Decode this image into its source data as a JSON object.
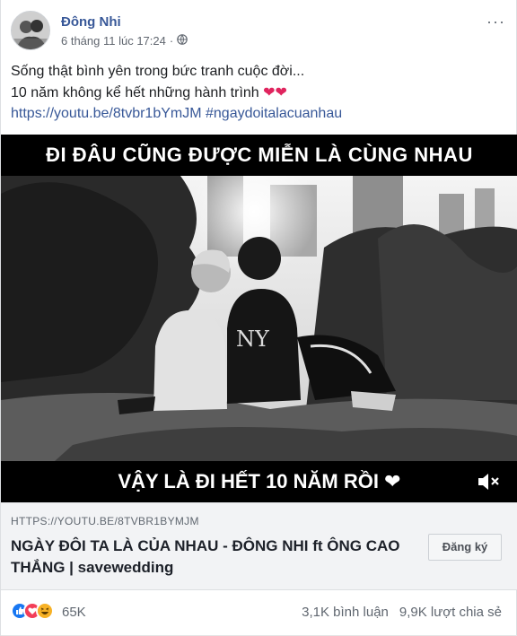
{
  "post": {
    "author": "Đông Nhi",
    "timestamp": "6 tháng 11 lúc 17:24",
    "separator": "·",
    "privacy_icon": "globe-icon",
    "more_icon": "more-options-icon",
    "more_label": "···",
    "text_line1": "Sống thật bình yên trong bức tranh cuộc đời...",
    "text_line2": "10 năm không kể hết những hành trình",
    "text_hearts": "❤❤",
    "link_text": "https://youtu.be/8tvbr1bYmJM #ngaydoitalacuanhau"
  },
  "video": {
    "caption_top": "ĐI ĐÂU CŨNG ĐƯỢC MIỄN LÀ CÙNG NHAU",
    "caption_bottom": "VẬY LÀ ĐI HẾT 10 NĂM RỒI ❤",
    "mute_icon": "mute-icon"
  },
  "preview": {
    "domain": "HTTPS://YOUTU.BE/8TVBR1BYMJM",
    "title": "NGÀY ĐÔI TA LÀ CỦA NHAU - ĐÔNG NHI ft ÔNG CAO THẮNG | savewedding",
    "subscribe_label": "Đăng ký"
  },
  "footer": {
    "reactions": [
      "like-icon",
      "love-icon",
      "haha-icon"
    ],
    "reaction_count": "65K",
    "comments": "3,1K bình luận",
    "shares": "9,9K lượt chia sẻ"
  },
  "colors": {
    "link": "#385898",
    "meta": "#616770",
    "like": "#1877f2",
    "love": "#f33e58",
    "haha": "#f7b125"
  }
}
